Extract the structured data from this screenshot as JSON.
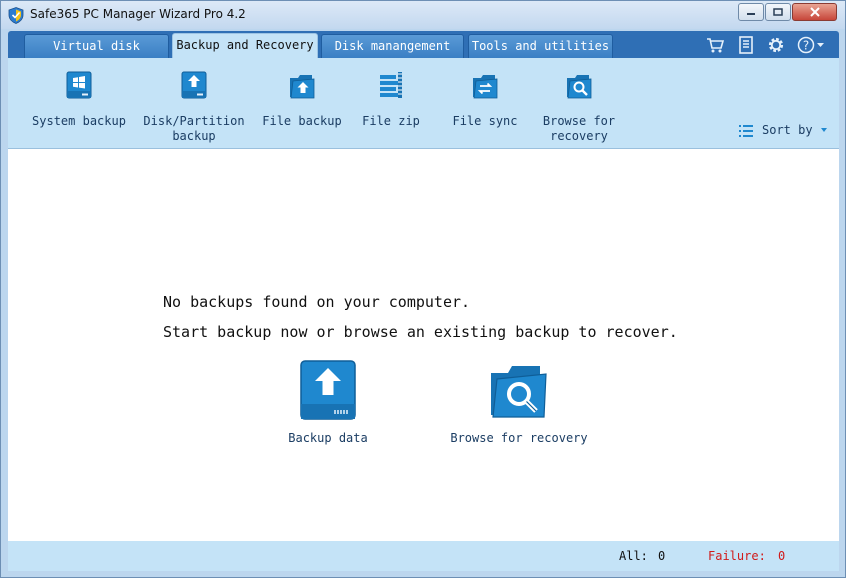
{
  "window": {
    "title": "Safe365 PC Manager Wizard Pro 4.2"
  },
  "tabs": [
    {
      "label": "Virtual disk",
      "active": false
    },
    {
      "label": "Backup and Recovery",
      "active": true
    },
    {
      "label": "Disk manangement",
      "active": false
    },
    {
      "label": "Tools and utilities",
      "active": false
    }
  ],
  "header_icons": [
    "cart-icon",
    "notes-icon",
    "gear-icon",
    "help-icon"
  ],
  "toolbar": {
    "items": [
      {
        "label": "System backup",
        "icon": "windows-drive-icon"
      },
      {
        "label": "Disk/Partition\nbackup",
        "icon": "drive-upload-icon"
      },
      {
        "label": "File backup",
        "icon": "folder-upload-icon"
      },
      {
        "label": "File zip",
        "icon": "file-zip-icon"
      },
      {
        "label": "File sync",
        "icon": "folder-sync-icon"
      },
      {
        "label": "Browse for\nrecovery",
        "icon": "folder-search-icon"
      }
    ],
    "sort_label": "Sort by"
  },
  "content": {
    "message_line1": "No backups found on your computer.",
    "message_line2": "Start backup now or browse an existing backup to recover.",
    "backup_data_label": "Backup data",
    "browse_recovery_label": "Browse for recovery"
  },
  "status": {
    "all_label": "All:",
    "all_value": "0",
    "failure_label": "Failure:",
    "failure_value": "0"
  },
  "colors": {
    "accent": "#1f88cf",
    "tab_strip": "#2f6fb5",
    "toolbar_bg": "#c4e3f7",
    "failure_red": "#d11a1a"
  }
}
